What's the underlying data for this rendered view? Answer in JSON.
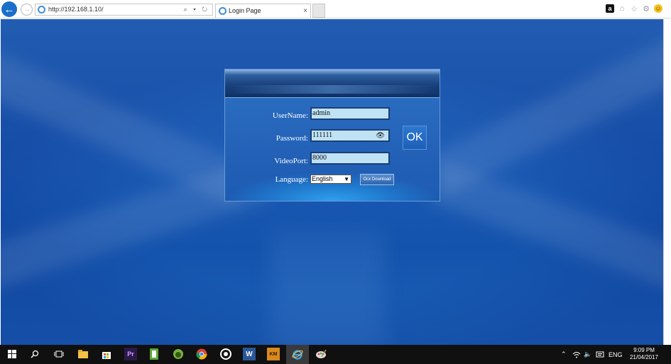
{
  "browser": {
    "url": "http://192.168.1.10/",
    "addr_tools": "⌕ ▾ ↻",
    "tab_title": "Login Page",
    "tab_close": "×",
    "back_icon": "←",
    "forward_icon": "→"
  },
  "login": {
    "username_label": "UserName:",
    "username_value": "admin",
    "password_label": "Password:",
    "password_value": "111111",
    "videoport_label": "VideoPort:",
    "videoport_value": "8000",
    "language_label": "Language:",
    "language_value": "English",
    "ok_label": "OK",
    "ocx_label": "Ocx Download"
  },
  "toolbar_icons": [
    "amazon-icon",
    "home-icon",
    "star-icon",
    "gear-icon",
    "smiley-icon"
  ],
  "taskbar": {
    "apps": [
      "start-icon",
      "search-icon",
      "task-view-icon",
      "file-explorer-icon",
      "store-icon",
      "premiere-icon",
      "notes-icon",
      "android-icon",
      "chrome-icon",
      "media-icon",
      "word-icon",
      "app-icon",
      "ie-icon",
      "paint-icon"
    ],
    "tray_language": "ENG",
    "time": "9:09 PM",
    "date": "21/04/2017"
  }
}
